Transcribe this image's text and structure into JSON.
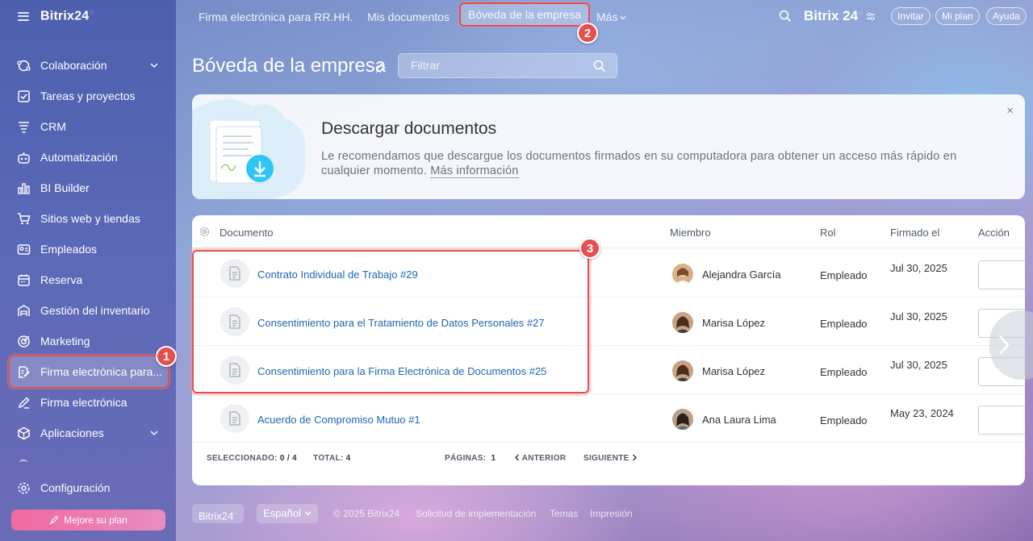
{
  "sidebar": {
    "logo": "Bitrix24",
    "logo_mark": "®",
    "items": [
      {
        "label": "Colaboración",
        "icon": "collaboration-icon",
        "has_submenu": true
      },
      {
        "label": "Tareas y proyectos",
        "icon": "tasks-icon"
      },
      {
        "label": "CRM",
        "icon": "crm-icon"
      },
      {
        "label": "Automatización",
        "icon": "automation-icon"
      },
      {
        "label": "BI Builder",
        "icon": "bi-builder-icon"
      },
      {
        "label": "Sitios web y tiendas",
        "icon": "cart-icon"
      },
      {
        "label": "Empleados",
        "icon": "employees-icon"
      },
      {
        "label": "Reserva",
        "icon": "calendar-icon"
      },
      {
        "label": "Gestión del inventario",
        "icon": "inventory-icon"
      },
      {
        "label": "Marketing",
        "icon": "marketing-icon"
      },
      {
        "label": "Firma electrónica para...",
        "icon": "signature-hr-icon",
        "active": true
      },
      {
        "label": "Firma electrónica",
        "icon": "pen-icon"
      },
      {
        "label": "Aplicaciones",
        "icon": "apps-icon",
        "has_submenu": true
      }
    ],
    "settings_label": "Configuración",
    "upgrade_label": "Mejore su plan"
  },
  "topnav": {
    "items": [
      "Firma electrónica para RR.HH.",
      "Mis documentos",
      "Bóveda de la empresa",
      "Más"
    ],
    "active": "Bóveda de la empresa",
    "brand": "Bitrix 24",
    "invite": "Invitar",
    "my_plan": "Mi plan",
    "help": "Ayuda"
  },
  "badges": {
    "one": "1",
    "two": "2",
    "three": "3"
  },
  "page": {
    "title": "Bóveda de la empresa",
    "filter_placeholder": "Filtrar"
  },
  "banner": {
    "title": "Descargar documentos",
    "text": "Le recomendamos que descargue los documentos firmados en su computadora para obtener un acceso más rápido en cualquier momento.",
    "link": "Más información",
    "close": "×"
  },
  "table": {
    "columns": [
      "Documento",
      "Miembro",
      "Rol",
      "Firmado el",
      "Acción"
    ],
    "rows": [
      {
        "document": "Contrato Individual de Trabajo #29",
        "member": "Alejandra García",
        "role": "Empleado",
        "date": "Jul 30, 2025"
      },
      {
        "document": "Consentimiento para el Tratamiento de Datos Personales #27",
        "member": "Marisa López",
        "role": "Empleado",
        "date": "Jul 30, 2025"
      },
      {
        "document": "Consentimiento para la Firma Electrónica de Documentos #25",
        "member": "Marisa López",
        "role": "Empleado",
        "date": "Jul 30, 2025"
      },
      {
        "document": "Acuerdo de Compromiso Mutuo #1",
        "member": "Ana Laura Lima",
        "role": "Empleado",
        "date": "May 23, 2024"
      }
    ],
    "footer": {
      "selected_label": "SELECCIONADO:",
      "selected_value": "0 / 4",
      "total_label": "TOTAL:",
      "total_value": "4",
      "pages_label": "PÁGINAS:",
      "pages_value": "1",
      "prev": "ANTERIOR",
      "next": "SIGUIENTE"
    }
  },
  "footer": {
    "brand": "Bitrix24",
    "language": "Español",
    "copyright": "© 2025 Bitrix24",
    "implementation": "Solicitud de implementación",
    "themes": "Temas",
    "print": "Impresión"
  },
  "colors": {
    "accent": "#2067b0",
    "highlight": "#e54e4e",
    "sidebar": "#5a69b7",
    "upgrade": "#f06a9f"
  }
}
